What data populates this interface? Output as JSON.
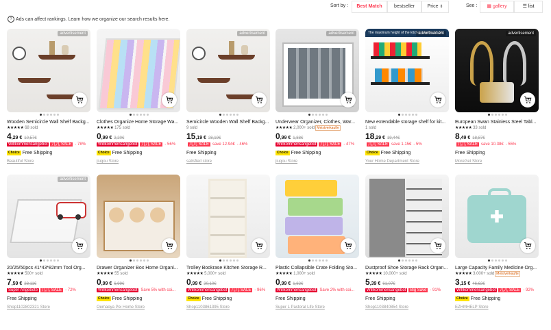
{
  "toolbar": {
    "sort_label": "Sort by :",
    "sort_options": [
      "Best Match",
      "bestseller",
      "Price"
    ],
    "see_label": "See :",
    "view_options": [
      "gallery",
      "list"
    ]
  },
  "ads_note": "Ads can affect rankings. Learn how we organize our search results here.",
  "products": [
    {
      "ad": "advertisement",
      "title": "Wooden Semicircle Wall Shelf Backg...",
      "rating": "68 sold",
      "stars": true,
      "price_int": "4",
      "price_dec": ",29 €",
      "old_price": "10,57€",
      "badge1": "Willkommensangebot",
      "badge2": "儿儿 SALE",
      "pct": "- 78%",
      "save": "",
      "choice": true,
      "ship": "Free Shipping",
      "store": "Beautiful Store",
      "tag": ""
    },
    {
      "ad": "",
      "title": "Clothes Organize Home Storage Wa...",
      "rating": "175 sold",
      "stars": true,
      "price_int": "0",
      "price_dec": ",99 €",
      "old_price": "2,20€",
      "badge1": "Willkommensangebot",
      "badge2": "儿儿 SALE",
      "pct": "- 56%",
      "save": "",
      "choice": true,
      "ship": "Free Shipping",
      "store": "jiugou Store",
      "tag": ""
    },
    {
      "ad": "advertisement",
      "title": "Semicircle Wooden Wall Shelf Backg...",
      "rating": "9 sold",
      "stars": false,
      "price_int": "15",
      "price_dec": ",19 €",
      "old_price": "28,19€",
      "badge1": "",
      "badge2": "儿儿 SALE",
      "pct": "- 46%",
      "save": "save 12.94€",
      "choice": false,
      "ship": "Free Shipping",
      "store": "satisfied store",
      "tag": ""
    },
    {
      "ad": "advertisement",
      "title": "Underwear Organizer, Clothes, War...",
      "rating": "2,000+ sold",
      "stars": true,
      "price_int": "0",
      "price_dec": ",99 €",
      "old_price": "1,88€",
      "badge1": "Willkommensangebot",
      "badge2": "儿儿 SALE",
      "pct": "- 47%",
      "save": "",
      "choice": true,
      "ship": "Free Shipping",
      "store": "jiugou Store",
      "tag": "Meistverkaufte"
    },
    {
      "ad": "advertisement",
      "title": "New extendable storage shelf for kit...",
      "rating": "1 sold",
      "stars": false,
      "price_int": "18",
      "price_dec": ",29 €",
      "old_price": "19,44€",
      "badge1": "",
      "badge2": "儿儿 SALE",
      "pct": "- 5%",
      "save": "save 1.15€",
      "choice": true,
      "ship": "Free Shipping",
      "store": "Your Home Department Store",
      "tag": ""
    },
    {
      "ad": "advertisement",
      "title": "European Swan Stainless Steel Tabl...",
      "rating": "33 sold",
      "stars": true,
      "price_int": "8",
      "price_dec": ",49 €",
      "old_price": "18,87€",
      "badge1": "",
      "badge2": "儿儿 SALE",
      "pct": "- 55%",
      "save": "save 10.38€",
      "choice": false,
      "ship": "Free Shipping",
      "store": "MoreGet Store",
      "tag": ""
    },
    {
      "ad": "advertisement",
      "title": "20/25/50pcs 41*43*82mm Tool Org...",
      "rating": "500+ sold",
      "stars": true,
      "price_int": "7",
      "price_dec": ",59 €",
      "old_price": "28,11€",
      "badge1": "Super Angebote",
      "badge2": "儿儿 SALE",
      "pct": "- 72%",
      "save": "",
      "choice": false,
      "ship": "Free Shipping",
      "store": "Shop1102802321 Store",
      "tag": ""
    },
    {
      "ad": "",
      "title": "Drawer Organizer Box Home Organi...",
      "rating": "55 sold",
      "stars": true,
      "price_int": "0",
      "price_dec": ",99 €",
      "old_price": "6,99€",
      "badge1": "Willkommensangebot",
      "badge2": "",
      "pct": "",
      "save": "Save 5% with coi...",
      "choice": true,
      "ship": "Free Shipping",
      "store": "Oemaoya Pei Home Store",
      "tag": ""
    },
    {
      "ad": "",
      "title": "Trolley Bookrase Kitchen Storage R...",
      "rating": "5,000+ sold",
      "stars": true,
      "price_int": "0",
      "price_dec": ",99 €",
      "old_price": "20,10€",
      "badge1": "Willkommensangebot",
      "badge2": "儿儿 SALE",
      "pct": "- 96%",
      "save": "",
      "choice": true,
      "ship": "Free Shipping",
      "store": "Shop1103861395 Store",
      "tag": ""
    },
    {
      "ad": "",
      "title": "Plastic Collapsible Crate Folding Sto...",
      "rating": "1,000+ sold",
      "stars": true,
      "price_int": "0",
      "price_dec": ",99 €",
      "old_price": "1,82€",
      "badge1": "Willkommensangebot",
      "badge2": "",
      "pct": "",
      "save": "Save 2% with coi...",
      "choice": false,
      "ship": "Free Shipping",
      "store": "Super L Pastoral Life Store",
      "tag": ""
    },
    {
      "ad": "",
      "title": "Dustproof Shoe Storage Rack Organ...",
      "rating": "10,000+ sold",
      "stars": true,
      "price_int": "5",
      "price_dec": ",39 €",
      "old_price": "61,07€",
      "badge1": "Willkommensangebot",
      "badge2": "Big Save",
      "pct": "- 91%",
      "save": "",
      "choice": false,
      "ship": "Free Shipping",
      "store": "Shop1103840854 Store",
      "tag": ""
    },
    {
      "ad": "",
      "title": "Large Capacity Family Medicine Org...",
      "rating": "3,000+ sold",
      "stars": true,
      "price_int": "3",
      "price_dec": ",15 €",
      "old_price": "46,62€",
      "badge1": "Willkommensangebot",
      "badge2": "儿儿 SALE",
      "pct": "- 92%",
      "save": "",
      "choice": true,
      "ship": "Free Shipping",
      "store": "EZHMHELP Store",
      "tag": "Meistverkaufte"
    }
  ],
  "special_texts": {
    "p5_banner": "The maximum height of the kitchen shelf is 11.8in",
    "choice_label": "Choice"
  },
  "colors": {
    "accent": "#fd384f",
    "badge_red": "#e6002f",
    "choice_yellow": "#ffe400"
  }
}
